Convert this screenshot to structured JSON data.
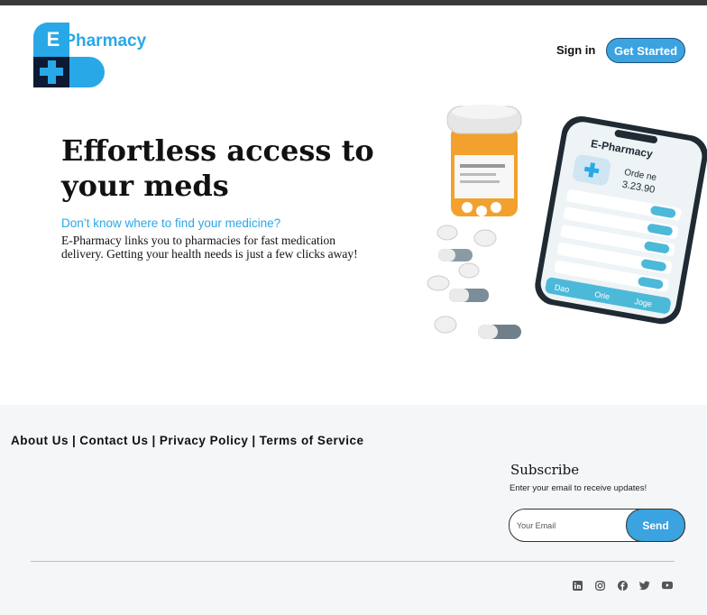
{
  "header": {
    "brand": "E-Pharmacy",
    "logo_letter": "E",
    "signin_label": "Sign in",
    "get_started_label": "Get Started"
  },
  "hero": {
    "title": "Effortless access to your meds",
    "subtitle": "Don’t know where to find your medicine?",
    "description": "E-Pharmacy links you to pharmacies for fast medication delivery. Getting your health needs is just a few clicks away!"
  },
  "phone": {
    "app_name": "E-Pharmacy",
    "order_label": "Orde ne",
    "order_amount": "3.23.90",
    "tabs": [
      "Dao",
      "Orie",
      "Joge"
    ]
  },
  "footer": {
    "links": [
      "About Us",
      "Contact Us",
      "Privacy Policy",
      "Terms of Service"
    ],
    "separator": "|",
    "subscribe_title": "Subscribe",
    "subscribe_text": "Enter your email to receive updates!",
    "email_placeholder": "Your Email",
    "send_label": "Send",
    "socials": [
      "linkedin-icon",
      "instagram-icon",
      "facebook-icon",
      "twitter-icon",
      "youtube-icon"
    ]
  },
  "colors": {
    "accent": "#29a8e8",
    "button": "#3aa3e0",
    "dark_navy": "#0e1a33",
    "footer_bg": "#f5f6f8"
  }
}
